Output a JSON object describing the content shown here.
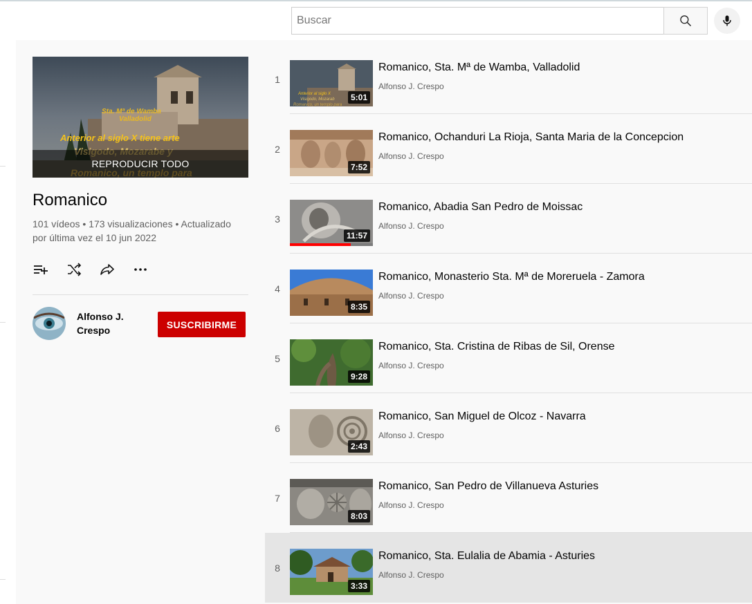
{
  "header": {
    "search_placeholder": "Buscar",
    "search_icon": "search-icon",
    "mic_icon": "microphone-icon"
  },
  "playlist": {
    "play_all_label": "REPRODUCIR TODO",
    "title": "Romanico",
    "stats_line1": "101 vídeos • 173 visualizaciones • Actualizado",
    "stats_line2": "por última vez el 10 jun 2022",
    "actions": [
      "add-to-queue-icon",
      "shuffle-icon",
      "share-icon",
      "more-options-icon"
    ],
    "owner": {
      "name": "Alfonso J. Crespo",
      "subscribe_label": "SUSCRIBIRME"
    }
  },
  "videos": [
    {
      "index": "1",
      "title": "Romanico, Sta. Mª de Wamba, Valladolid",
      "channel": "Alfonso J. Crespo",
      "duration": "5:01"
    },
    {
      "index": "2",
      "title": "Romanico, Ochanduri La Rioja, Santa Maria de la Concepcion",
      "channel": "Alfonso J. Crespo",
      "duration": "7:52"
    },
    {
      "index": "3",
      "title": "Romanico, Abadia San Pedro de Moissac",
      "channel": "Alfonso J. Crespo",
      "duration": "11:57",
      "watched_fraction": 0.73
    },
    {
      "index": "4",
      "title": "Romanico, Monasterio Sta. Mª de Moreruela - Zamora",
      "channel": "Alfonso J. Crespo",
      "duration": "8:35"
    },
    {
      "index": "5",
      "title": "Romanico, Sta. Cristina de Ribas de Sil, Orense",
      "channel": "Alfonso J. Crespo",
      "duration": "9:28"
    },
    {
      "index": "6",
      "title": "Romanico, San Miguel de Olcoz - Navarra",
      "channel": "Alfonso J. Crespo",
      "duration": "2:43"
    },
    {
      "index": "7",
      "title": "Romanico, San Pedro de Villanueva Asturies",
      "channel": "Alfonso J. Crespo",
      "duration": "8:03"
    },
    {
      "index": "8",
      "title": "Romanico, Sta. Eulalia de Abamia - Asturies",
      "channel": "Alfonso J. Crespo",
      "duration": "3:33",
      "active": true
    }
  ],
  "colors": {
    "subscribe": "#cc0000",
    "progress": "#ff0000"
  }
}
